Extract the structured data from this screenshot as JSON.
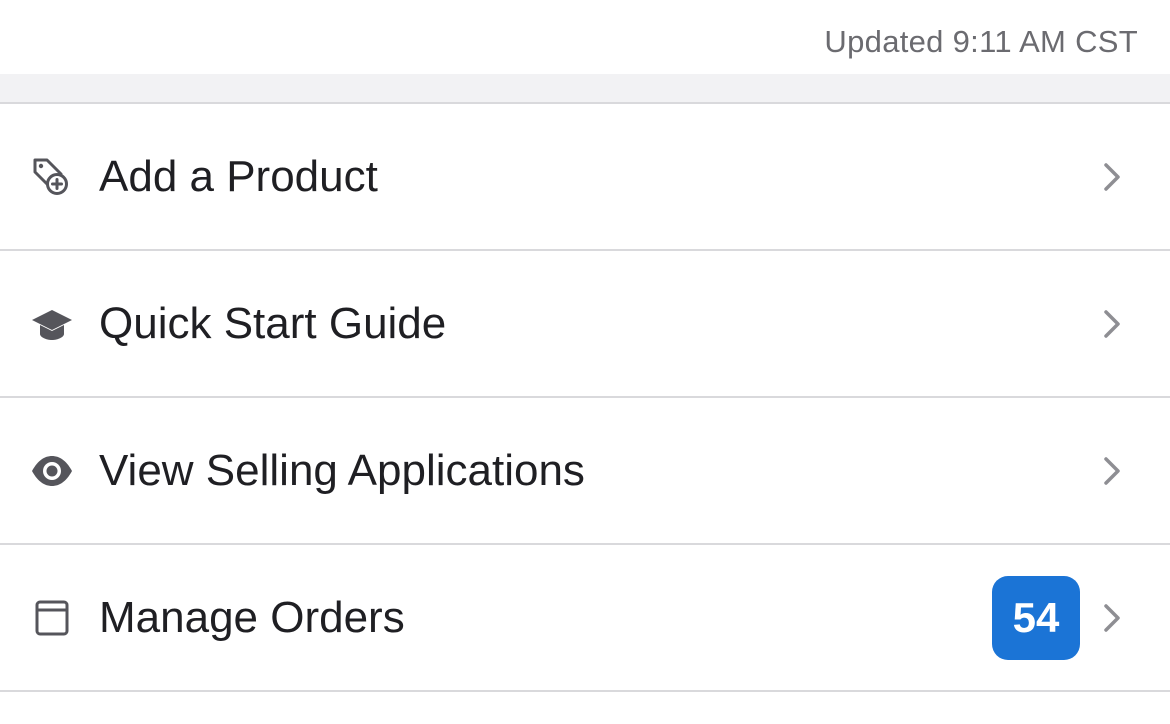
{
  "header": {
    "updated_text": "Updated 9:11 AM CST"
  },
  "menu": {
    "items": [
      {
        "label": "Add a Product",
        "icon": "tag-plus-icon"
      },
      {
        "label": "Quick Start Guide",
        "icon": "graduation-cap-icon"
      },
      {
        "label": "View Selling Applications",
        "icon": "eye-icon"
      },
      {
        "label": "Manage Orders",
        "icon": "archive-box-icon",
        "badge": "54"
      }
    ]
  },
  "colors": {
    "badge_background": "#1b74d6",
    "icon_color": "#55555b",
    "chevron_color": "#8e8e93"
  }
}
